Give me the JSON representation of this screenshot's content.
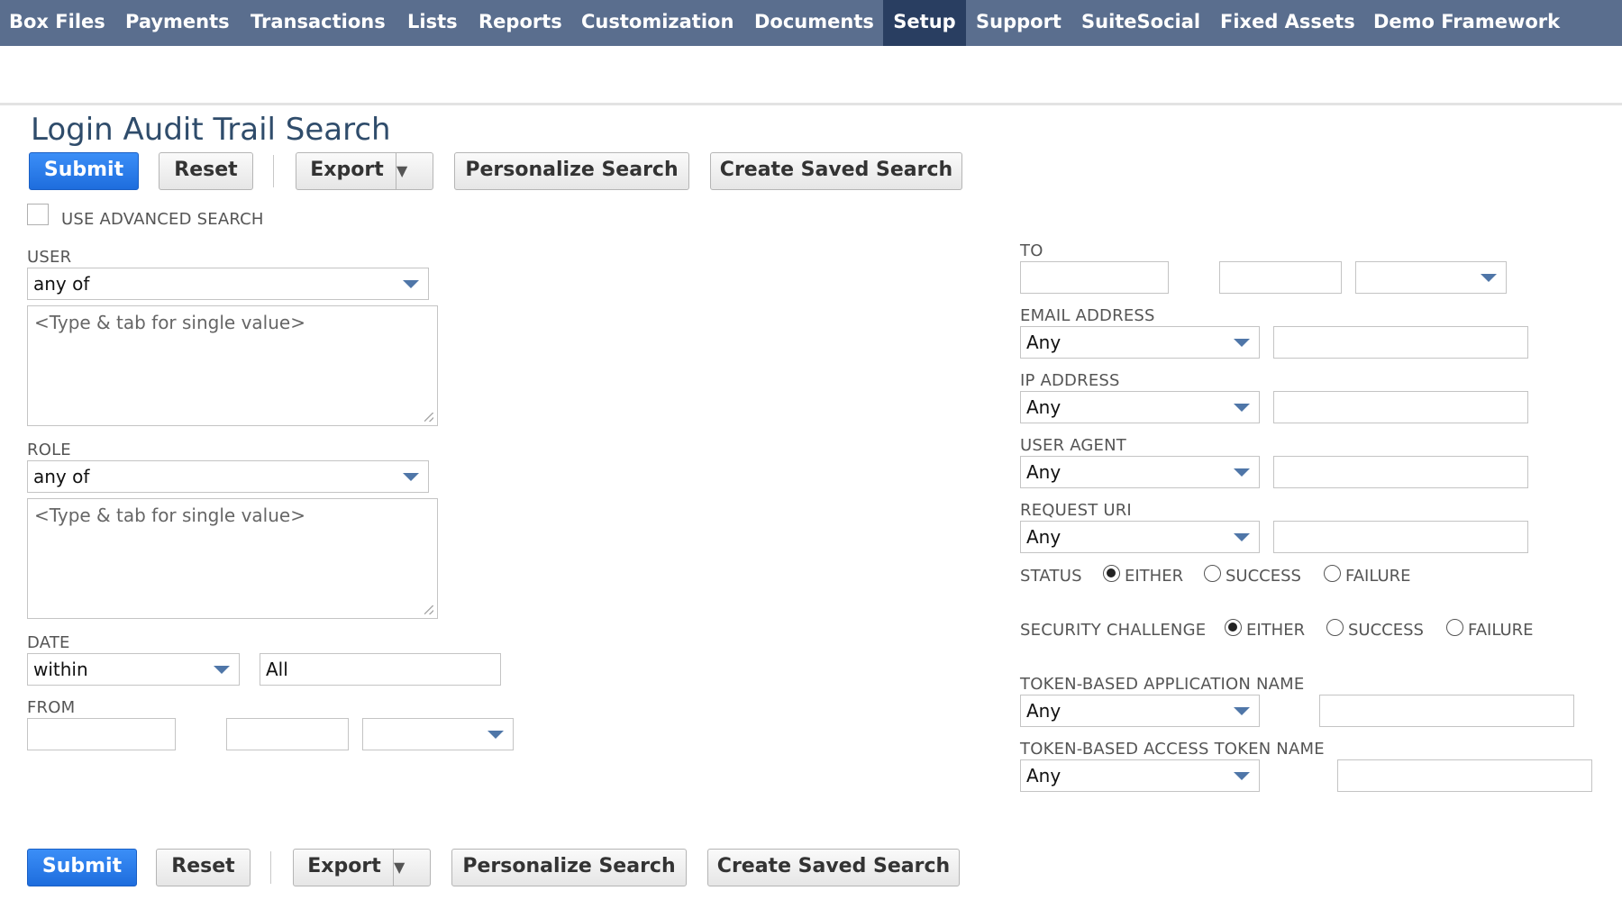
{
  "nav": {
    "items": [
      "Box Files",
      "Payments",
      "Transactions",
      "Lists",
      "Reports",
      "Customization",
      "Documents",
      "Setup",
      "Support",
      "SuiteSocial",
      "Fixed Assets",
      "Demo Framework"
    ],
    "active": "Setup"
  },
  "page": {
    "title": "Login Audit Trail Search"
  },
  "toolbar": {
    "submit": "Submit",
    "reset": "Reset",
    "export": "Export",
    "export_arrow": "▼",
    "personalize": "Personalize Search",
    "create_saved": "Create Saved Search"
  },
  "advanced": {
    "label": "USE ADVANCED SEARCH"
  },
  "user": {
    "label": "USER",
    "operator": "any of",
    "placeholder": "<Type & tab for single value>"
  },
  "role": {
    "label": "ROLE",
    "operator": "any of",
    "placeholder": "<Type & tab for single value>"
  },
  "date": {
    "label": "DATE",
    "operator": "within",
    "value": "All"
  },
  "from": {
    "label": "FROM"
  },
  "to": {
    "label": "TO"
  },
  "email": {
    "label": "EMAIL ADDRESS",
    "operator": "Any"
  },
  "ip": {
    "label": "IP ADDRESS",
    "operator": "Any"
  },
  "user_agent": {
    "label": "USER AGENT",
    "operator": "Any"
  },
  "request_uri": {
    "label": "REQUEST URI",
    "operator": "Any"
  },
  "status": {
    "label": "STATUS",
    "options": [
      "EITHER",
      "SUCCESS",
      "FAILURE"
    ],
    "selected": "EITHER"
  },
  "security": {
    "label": "SECURITY CHALLENGE",
    "options": [
      "EITHER",
      "SUCCESS",
      "FAILURE"
    ],
    "selected": "EITHER"
  },
  "token_app": {
    "label": "TOKEN-BASED APPLICATION NAME",
    "operator": "Any"
  },
  "token_access": {
    "label": "TOKEN-BASED ACCESS TOKEN NAME",
    "operator": "Any"
  },
  "colors": {
    "nav_bg": "#5a6e8e",
    "nav_active": "#293e61",
    "primary": "#1e6ddd",
    "title": "#2f4c6b",
    "caret": "#4f76a8"
  }
}
